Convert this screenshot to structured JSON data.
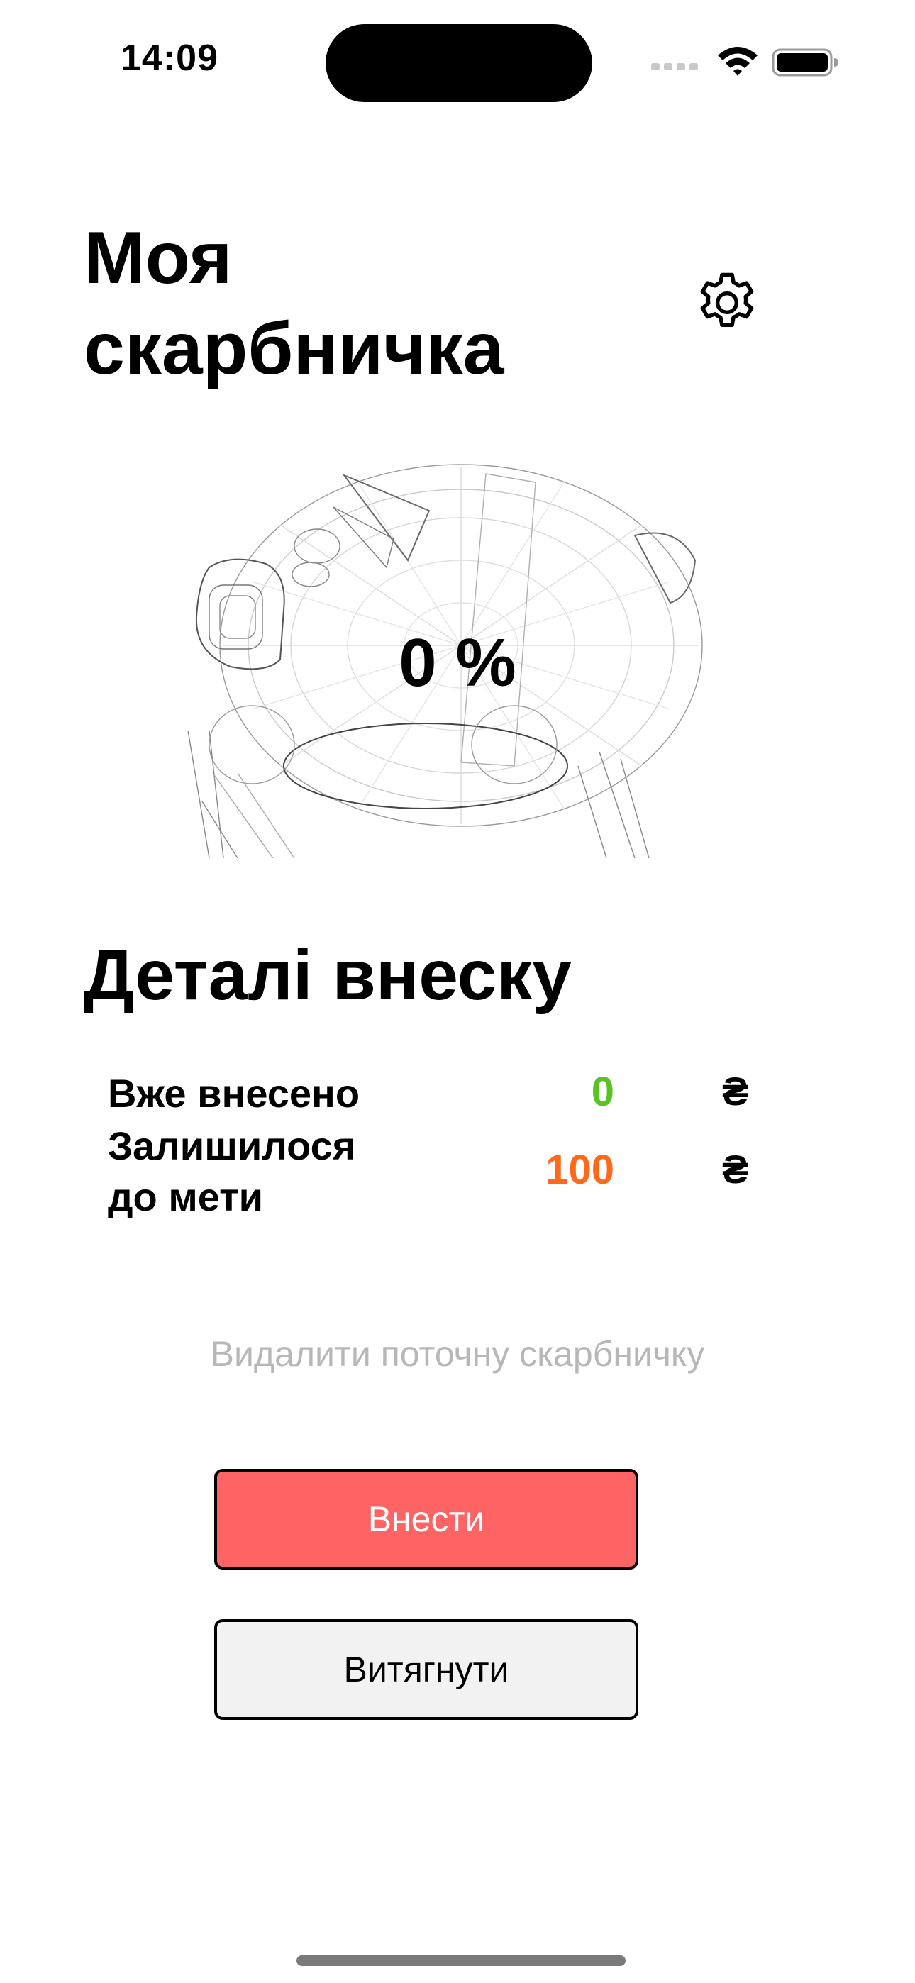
{
  "status_bar": {
    "time": "14:09"
  },
  "header": {
    "title_line1": "Моя",
    "title_line2": "скарбничка",
    "settings_icon": "gear-icon"
  },
  "piggy": {
    "progress_label": "0 %",
    "progress_percent": 0
  },
  "details": {
    "title": "Деталі внеску",
    "rows": [
      {
        "label_line1": "Вже внесено",
        "label_line2": "",
        "value": "0",
        "currency": "₴",
        "color": "#58c322"
      },
      {
        "label_line1": "Залишилося",
        "label_line2": "до мети",
        "value": "100",
        "currency": "₴",
        "color": "#ff6a1a"
      }
    ]
  },
  "actions": {
    "delete_label": "Видалити поточну скарбничку",
    "deposit_label": "Внести",
    "withdraw_label": "Витягнути",
    "deposit_color": "#ff6464",
    "withdraw_color": "#f2f2f2"
  }
}
